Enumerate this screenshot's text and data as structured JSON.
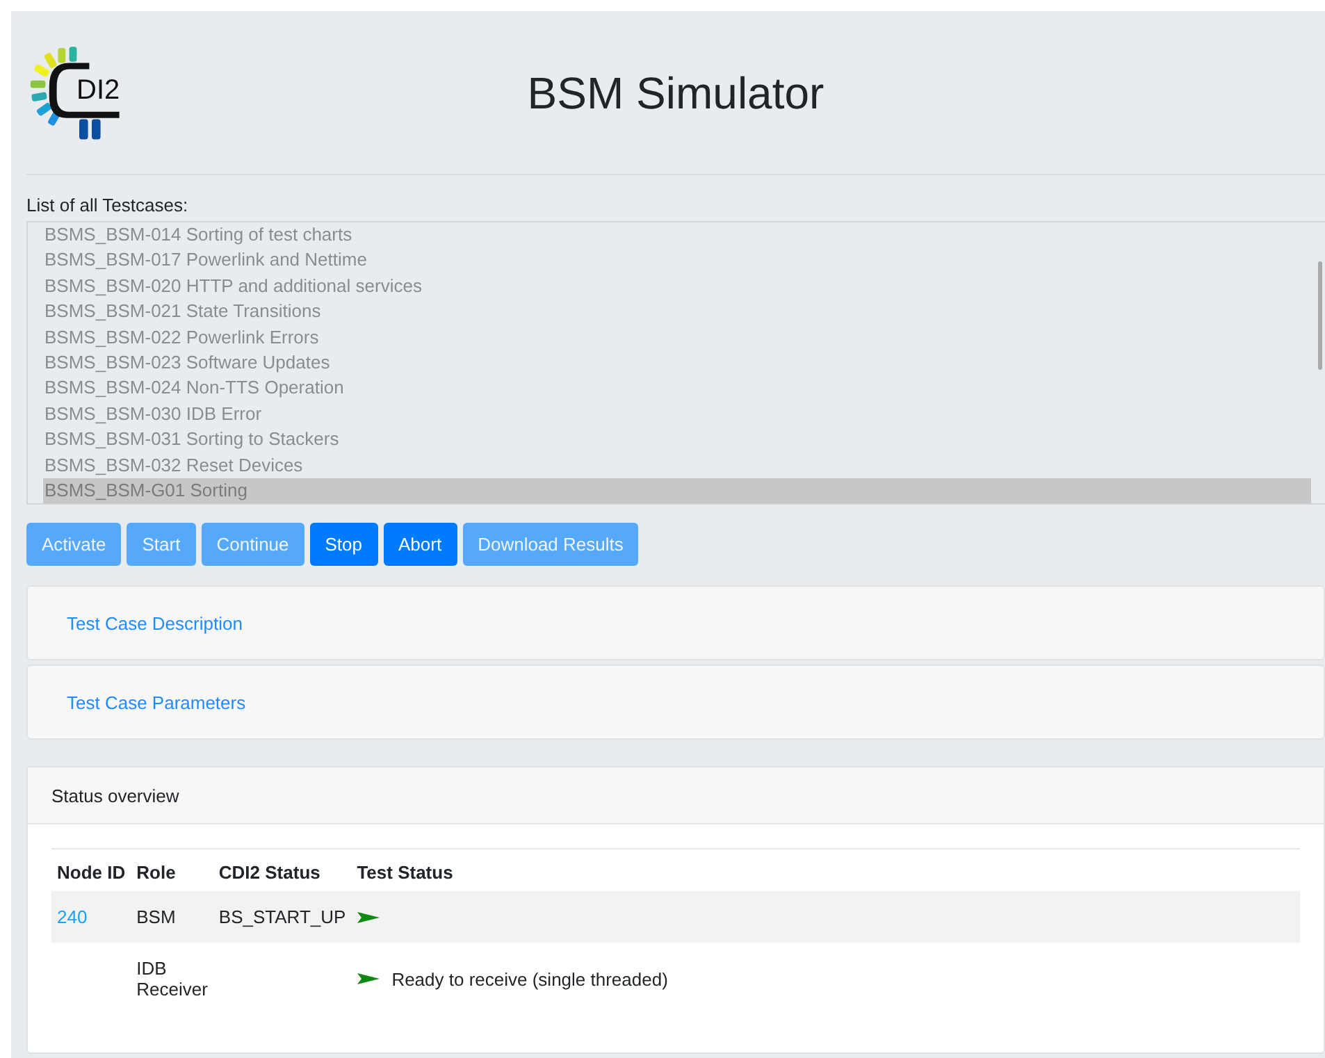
{
  "header": {
    "logo_text": "DI2",
    "title": "BSM Simulator"
  },
  "testcases": {
    "label": "List of all Testcases:",
    "items": [
      {
        "label": "BSMS_BSM-014 Sorting of test charts",
        "selected": false
      },
      {
        "label": "BSMS_BSM-017 Powerlink and Nettime",
        "selected": false
      },
      {
        "label": "BSMS_BSM-020 HTTP and additional services",
        "selected": false
      },
      {
        "label": "BSMS_BSM-021 State Transitions",
        "selected": false
      },
      {
        "label": "BSMS_BSM-022 Powerlink Errors",
        "selected": false
      },
      {
        "label": "BSMS_BSM-023 Software Updates",
        "selected": false
      },
      {
        "label": "BSMS_BSM-024 Non-TTS Operation",
        "selected": false
      },
      {
        "label": "BSMS_BSM-030 IDB Error",
        "selected": false
      },
      {
        "label": "BSMS_BSM-031 Sorting to Stackers",
        "selected": false
      },
      {
        "label": "BSMS_BSM-032 Reset Devices",
        "selected": false
      },
      {
        "label": "BSMS_BSM-G01 Sorting",
        "selected": true
      }
    ]
  },
  "buttons": [
    {
      "label": "Activate",
      "disabled": true
    },
    {
      "label": "Start",
      "disabled": true
    },
    {
      "label": "Continue",
      "disabled": true
    },
    {
      "label": "Stop",
      "disabled": false
    },
    {
      "label": "Abort",
      "disabled": false
    },
    {
      "label": "Download Results",
      "disabled": true
    }
  ],
  "panels": [
    {
      "title": "Test Case Description"
    },
    {
      "title": "Test Case Parameters"
    }
  ],
  "status": {
    "title": "Status overview",
    "columns": [
      "Node ID",
      "Role",
      "CDI2 Status",
      "Test Status"
    ],
    "rows": [
      {
        "node_id": "240",
        "role": "BSM",
        "cdi2_status": "BS_START_UP"
      },
      {
        "role": "IDB Receiver",
        "test_status": "Ready to receive (single threaded)"
      }
    ]
  }
}
